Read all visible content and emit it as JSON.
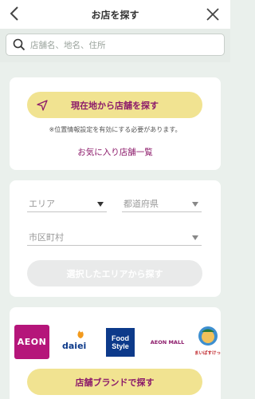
{
  "header": {
    "title": "お店を探す"
  },
  "search": {
    "placeholder": "店舗名、地名、住所"
  },
  "location_card": {
    "current_location_button": "現在地から店舗を探す",
    "note": "※位置情報設定を有効にする必要があります。",
    "favorites_link": "お気に入り店舗一覧"
  },
  "area_card": {
    "area_select": "エリア",
    "prefecture_select": "都道府県",
    "city_select": "市区町村",
    "search_button": "選択したエリアから探す"
  },
  "brand_card": {
    "brands": [
      "AEON",
      "daiei",
      "Food Style",
      "AEON MALL",
      "まいばすけっと"
    ],
    "brand_button": "店舗ブランドで探す"
  },
  "colors": {
    "accent": "#8c1a6a",
    "button_yellow": "#f1e391",
    "aeon_magenta": "#b5157a"
  }
}
